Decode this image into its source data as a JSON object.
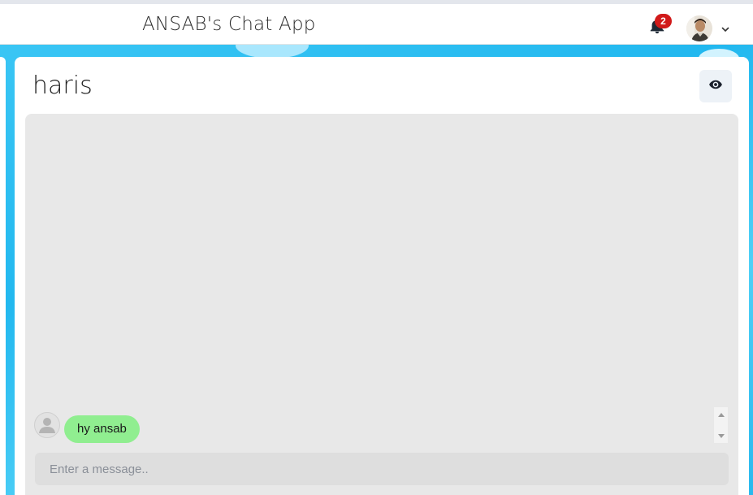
{
  "header": {
    "app_title": "ANSAB's Chat App",
    "notification_count": "2",
    "bell_icon": "bell-icon",
    "avatar_icon": "user-avatar",
    "chevron_icon": "chevron-down-icon"
  },
  "chat": {
    "contact_name": "haris",
    "view_profile_icon": "eye-icon",
    "messages": [
      {
        "text": "hy ansab",
        "avatar": "default-user-icon",
        "bubble_color": "#90ee90"
      }
    ],
    "input": {
      "placeholder": "Enter a message..",
      "value": ""
    }
  },
  "colors": {
    "background_accent": "#22b8ef",
    "badge": "#d11a1a",
    "message_bubble": "#90ee90",
    "messages_area": "#e8e8e8"
  }
}
